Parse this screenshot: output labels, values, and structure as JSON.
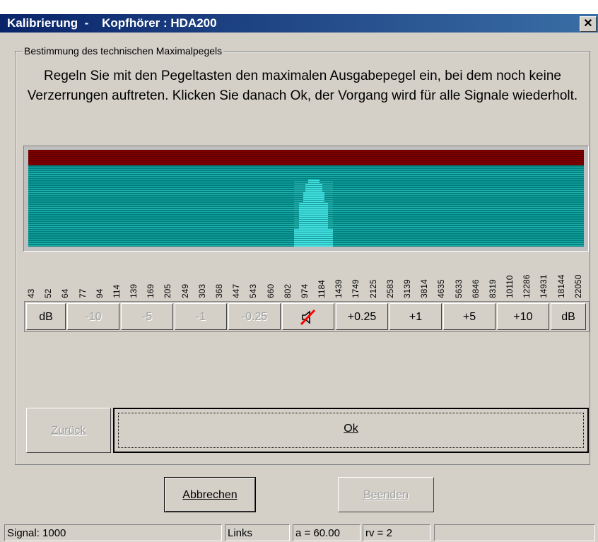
{
  "window": {
    "title": "Kalibrierung  -    Kopfhörer : HDA200",
    "close_glyph": "✕"
  },
  "group": {
    "label": "Bestimmung des technischen Maximalpegels",
    "instruction": "Regeln Sie mit den Pegeltasten den maximalen Ausgabepegel ein, bei dem noch keine Verzerrungen auftreten. Klicken Sie danach Ok, der Vorgang wird für alle Signale wiederholt."
  },
  "spectrum": {
    "colors": {
      "background": "#008080",
      "lines": "#20b2aa",
      "top_band": "#800000",
      "signal": "#40e0e0",
      "frame": "#c0c0c0"
    },
    "frequencies": [
      "43",
      "52",
      "64",
      "77",
      "94",
      "114",
      "139",
      "169",
      "205",
      "249",
      "303",
      "368",
      "447",
      "543",
      "660",
      "802",
      "974",
      "1184",
      "1439",
      "1749",
      "2125",
      "2583",
      "3139",
      "3814",
      "4635",
      "5633",
      "6846",
      "8319",
      "10110",
      "12286",
      "14931",
      "18144",
      "22050"
    ]
  },
  "level_buttons": [
    {
      "label": "dB",
      "enabled": true
    },
    {
      "label": "-10",
      "enabled": false
    },
    {
      "label": "-5",
      "enabled": false
    },
    {
      "label": "-1",
      "enabled": false
    },
    {
      "label": "-0.25",
      "enabled": false
    },
    {
      "label": "",
      "icon": "mute-icon",
      "enabled": true
    },
    {
      "label": "+0.25",
      "enabled": true
    },
    {
      "label": "+1",
      "enabled": true
    },
    {
      "label": "+5",
      "enabled": true
    },
    {
      "label": "+10",
      "enabled": true
    },
    {
      "label": "dB",
      "enabled": true
    }
  ],
  "nav": {
    "back_label": "Zurück",
    "ok_label": "Ok"
  },
  "dialog_buttons": {
    "cancel_label": "Abbrechen",
    "finish_label": "Beenden"
  },
  "status": {
    "signal": "Signal: 1000",
    "side": "Links",
    "a_value": "a = 60.00",
    "rv_value": "rv = 2",
    "extra": ""
  }
}
